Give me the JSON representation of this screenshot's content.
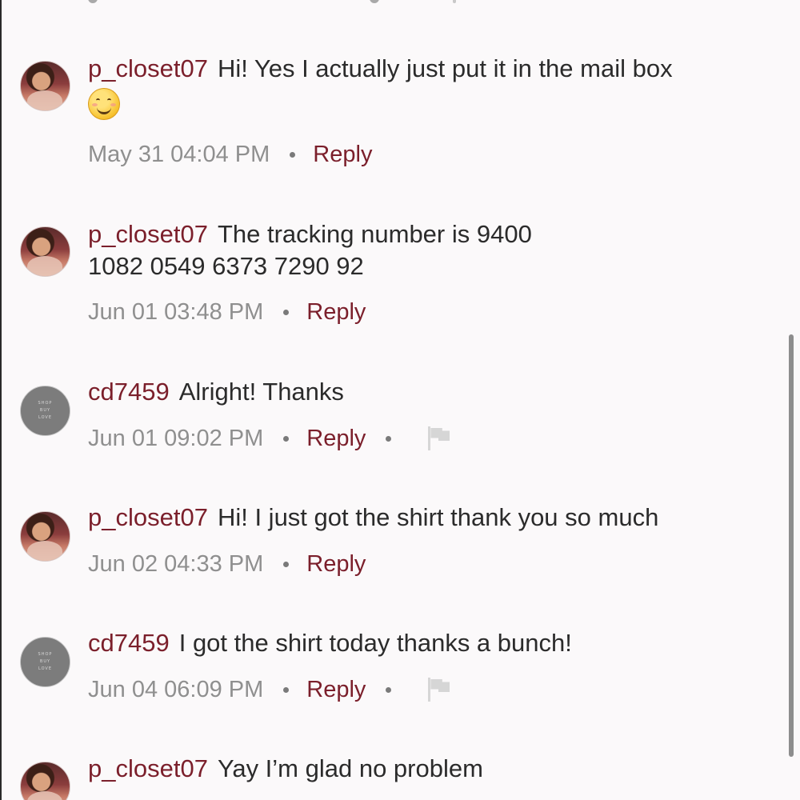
{
  "comments": [
    {
      "username": "p_closet07",
      "text": "Hi! Yes I actually just put it in the mail box",
      "has_emoji": true,
      "emoji_name": "smiling-face-emoji",
      "date": "May 31 04:04 PM",
      "reply_label": "Reply",
      "avatar": "photo"
    },
    {
      "username": "p_closet07",
      "text": "The tracking number is 9400 1082 0549 6373 7290 92",
      "date": "Jun 01 03:48 PM",
      "reply_label": "Reply",
      "avatar": "photo"
    },
    {
      "username": "cd7459",
      "text": "Alright! Thanks",
      "date": "Jun 01 09:02 PM",
      "reply_label": "Reply",
      "has_flag": true,
      "avatar": "shop-buy-love"
    },
    {
      "username": "p_closet07",
      "text": "Hi! I just got the shirt thank you so much",
      "date": "Jun 02 04:33 PM",
      "reply_label": "Reply",
      "avatar": "photo"
    },
    {
      "username": "cd7459",
      "text": "I got the shirt today thanks a bunch!",
      "date": "Jun 04 06:09 PM",
      "reply_label": "Reply",
      "has_flag": true,
      "avatar": "shop-buy-love"
    },
    {
      "username": "p_closet07",
      "text": "Yay I’m glad no problem",
      "avatar": "photo"
    }
  ],
  "avatar_shop_lines": [
    "SHOP",
    "BUY",
    "LOVE"
  ],
  "colors": {
    "username": "#7b1f2b",
    "reply": "#7b1f2b",
    "date": "#8f8f8f",
    "text": "#2b2b2b",
    "background": "#fbf9fa"
  }
}
